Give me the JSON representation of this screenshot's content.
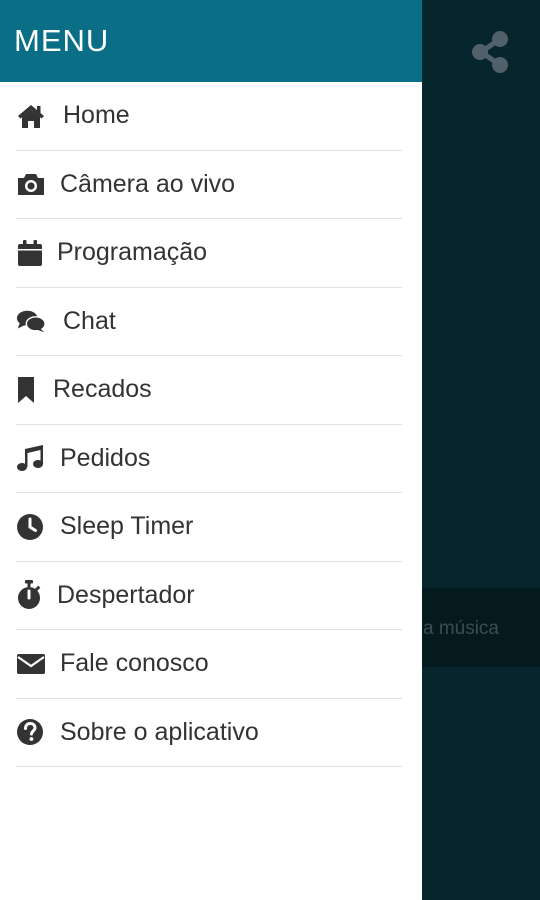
{
  "drawer": {
    "title": "MENU",
    "items": [
      {
        "label": "Home",
        "icon": "home-icon"
      },
      {
        "label": "Câmera ao vivo",
        "icon": "camera-icon"
      },
      {
        "label": "Programação",
        "icon": "calendar-icon"
      },
      {
        "label": "Chat",
        "icon": "chat-icon"
      },
      {
        "label": "Recados",
        "icon": "bookmark-icon"
      },
      {
        "label": "Pedidos",
        "icon": "music-icon"
      },
      {
        "label": "Sleep Timer",
        "icon": "clock-icon"
      },
      {
        "label": "Despertador",
        "icon": "stopwatch-icon"
      },
      {
        "label": "Fale conosco",
        "icon": "envelope-icon"
      },
      {
        "label": "Sobre o aplicativo",
        "icon": "question-icon"
      }
    ]
  },
  "background": {
    "now_playing_partial": "a música",
    "share_icon": "share-icon"
  },
  "colors": {
    "header": "#0a6f86",
    "background": "#07252c",
    "text": "#333333"
  }
}
